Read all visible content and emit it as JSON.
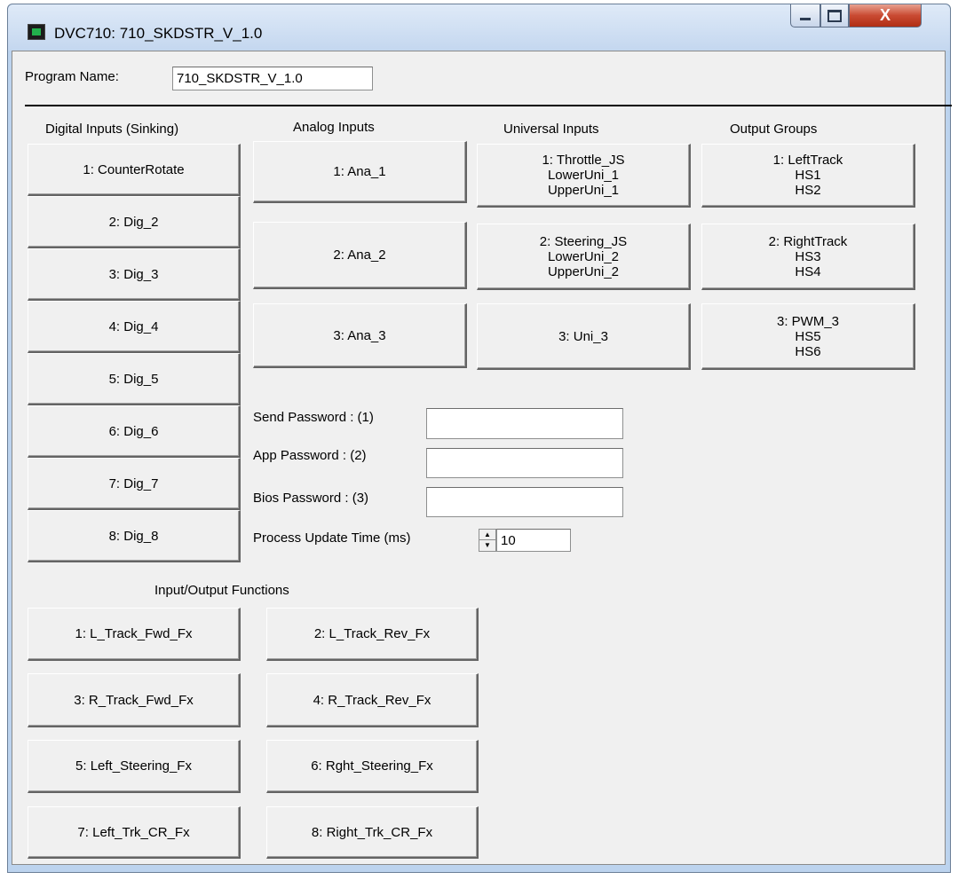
{
  "window": {
    "title": "DVC710: 710_SKDSTR_V_1.0",
    "close_glyph": "X"
  },
  "program": {
    "label": "Program Name:",
    "value": "710_SKDSTR_V_1.0"
  },
  "sections": {
    "digital": "Digital Inputs (Sinking)",
    "analog": "Analog Inputs",
    "universal": "Universal Inputs",
    "outputs": "Output Groups",
    "io_functions": "Input/Output Functions"
  },
  "digital_inputs": [
    "1: CounterRotate",
    "2: Dig_2",
    "3: Dig_3",
    "4: Dig_4",
    "5: Dig_5",
    "6: Dig_6",
    "7: Dig_7",
    "8: Dig_8"
  ],
  "analog_inputs": [
    "1: Ana_1",
    "2: Ana_2",
    "3: Ana_3"
  ],
  "universal_inputs": [
    [
      "1: Throttle_JS",
      "LowerUni_1",
      "UpperUni_1"
    ],
    [
      "2: Steering_JS",
      "LowerUni_2",
      "UpperUni_2"
    ],
    [
      "3: Uni_3"
    ]
  ],
  "output_groups": [
    [
      "1: LeftTrack",
      "HS1",
      "HS2"
    ],
    [
      "2: RightTrack",
      "HS3",
      "HS4"
    ],
    [
      "3: PWM_3",
      "HS5",
      "HS6"
    ]
  ],
  "passwords": {
    "send_label": "Send Password : (1)",
    "send_value": "",
    "app_label": "App Password : (2)",
    "app_value": "",
    "bios_label": "Bios Password : (3)",
    "bios_value": ""
  },
  "process_update": {
    "label": "Process Update Time (ms)",
    "value": "10"
  },
  "io_functions": [
    "1: L_Track_Fwd_Fx",
    "2: L_Track_Rev_Fx",
    "3: R_Track_Fwd_Fx",
    "4: R_Track_Rev_Fx",
    "5: Left_Steering_Fx",
    "6: Rght_Steering_Fx",
    "7: Left_Trk_CR_Fx",
    "8: Right_Trk_CR_Fx"
  ],
  "icons": {
    "app": "app-chip-icon",
    "minimize": "minimize-icon",
    "maximize": "maximize-icon",
    "close": "close-icon"
  }
}
